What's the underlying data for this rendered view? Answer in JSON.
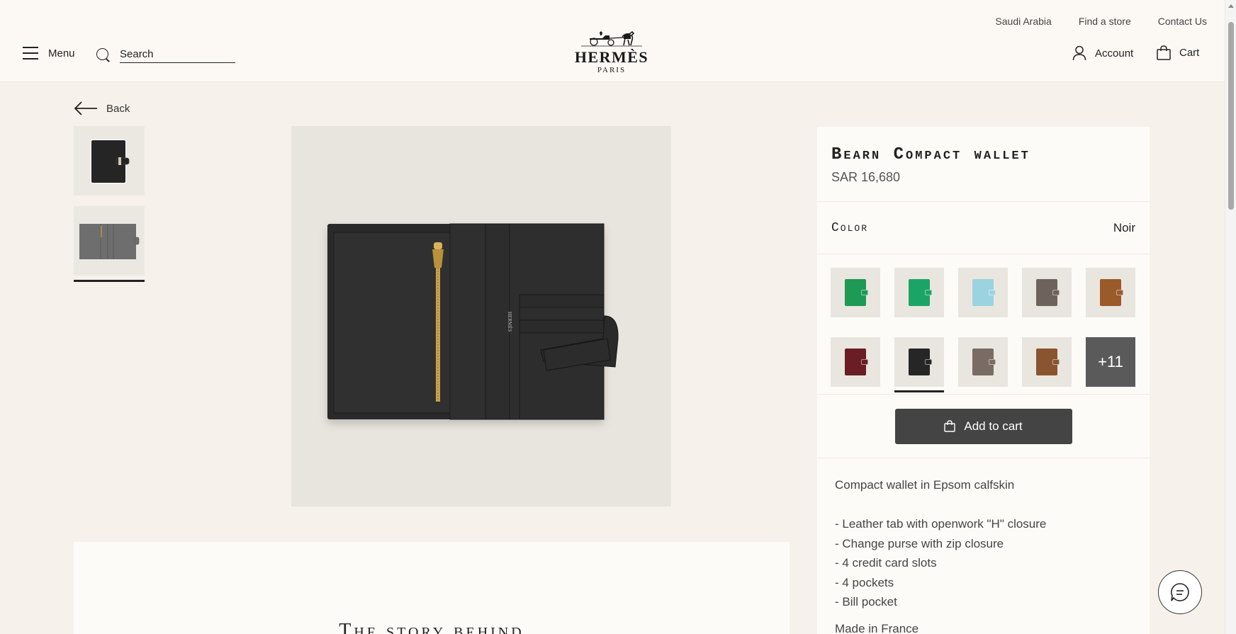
{
  "header": {
    "util_links": [
      "Saudi Arabia",
      "Find a store",
      "Contact Us"
    ],
    "menu_label": "Menu",
    "search_placeholder": "Search",
    "logo_brand": "HERMÈS",
    "logo_city": "PARIS",
    "account_label": "Account",
    "cart_label": "Cart"
  },
  "nav": {
    "back_label": "Back"
  },
  "gallery": {
    "thumbnails": [
      {
        "name": "thumb-wallet-closed",
        "active": false
      },
      {
        "name": "thumb-wallet-open",
        "active": true
      }
    ]
  },
  "product": {
    "title": "Bearn Compact wallet",
    "price": "SAR 16,680",
    "color_label": "Color",
    "color_value": "Noir",
    "swatch_colors": [
      "#1e9a55",
      "#1aa566",
      "#9cd3e0",
      "#6e625c",
      "#9b5a2a",
      "#6a1d24",
      "#262626",
      "#7a6c64",
      "#8a5430"
    ],
    "swatch_selected_index": 6,
    "more_colors_label": "+11",
    "add_to_cart_label": "Add to cart",
    "description": {
      "intro": "Compact wallet in Epsom calfskin",
      "features": [
        "- Leather tab with openwork \"H\" closure",
        "- Change purse with zip closure",
        "- 4 credit card slots",
        "- 4 pockets",
        "- Bill pocket"
      ],
      "origin": "Made in France"
    }
  },
  "story": {
    "heading": "The story behind"
  },
  "colors": {
    "wallet": "#2b2b2c",
    "zip": "#c8a24a",
    "button": "#444444",
    "panel": "#fdfbf8"
  }
}
